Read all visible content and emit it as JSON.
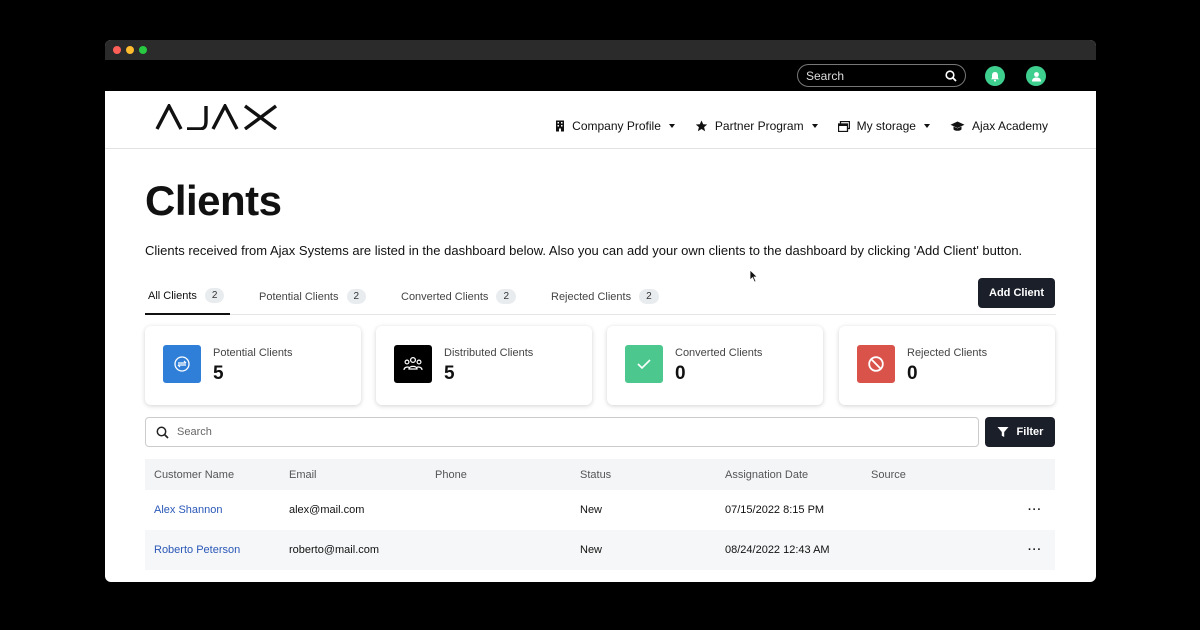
{
  "topbar": {
    "search_placeholder": "Search"
  },
  "brand": {
    "logo_text": "AJAX"
  },
  "nav": {
    "items": [
      {
        "label": "Company Profile",
        "icon": "building-icon",
        "dropdown": true
      },
      {
        "label": "Partner Program",
        "icon": "star-icon",
        "dropdown": true
      },
      {
        "label": "My storage",
        "icon": "storage-icon",
        "dropdown": true
      },
      {
        "label": "Ajax Academy",
        "icon": "graduation-cap-icon",
        "dropdown": false
      }
    ]
  },
  "page": {
    "title": "Clients",
    "intro": "Clients received from Ajax Systems are listed in the dashboard below. Also you can add your own clients to the dashboard by clicking 'Add Client' button."
  },
  "tabs": [
    {
      "label": "All Clients",
      "count": "2",
      "active": true
    },
    {
      "label": "Potential Clients",
      "count": "2"
    },
    {
      "label": "Converted Clients",
      "count": "2"
    },
    {
      "label": "Rejected Clients",
      "count": "2"
    }
  ],
  "add_client_label": "Add Client",
  "cards": [
    {
      "label": "Potential Clients",
      "value": "5",
      "color": "#2f7fd9",
      "icon": "potential-clients-icon"
    },
    {
      "label": "Distributed Clients",
      "value": "5",
      "color": "#000000",
      "icon": "group-icon"
    },
    {
      "label": "Converted Clients",
      "value": "0",
      "color": "#4cc88f",
      "icon": "check-icon"
    },
    {
      "label": "Rejected Clients",
      "value": "0",
      "color": "#d9534a",
      "icon": "block-icon"
    }
  ],
  "search": {
    "placeholder": "Search"
  },
  "filter_label": "Filter",
  "table": {
    "columns": [
      "Customer Name",
      "Email",
      "Phone",
      "Status",
      "Assignation Date",
      "Source"
    ],
    "rows": [
      {
        "name": "Alex Shannon",
        "email": "alex@mail.com",
        "phone": "",
        "status": "New",
        "date": "07/15/2022 8:15 PM",
        "source": "",
        "menu": "···"
      },
      {
        "name": "Roberto Peterson",
        "email": "roberto@mail.com",
        "phone": "",
        "status": "New",
        "date": "08/24/2022 12:43 AM",
        "source": "",
        "menu": "···"
      }
    ]
  },
  "colors": {
    "dark_button": "#1b1f2a",
    "accent_green": "#3ecf8e",
    "link": "#2a58b8"
  }
}
